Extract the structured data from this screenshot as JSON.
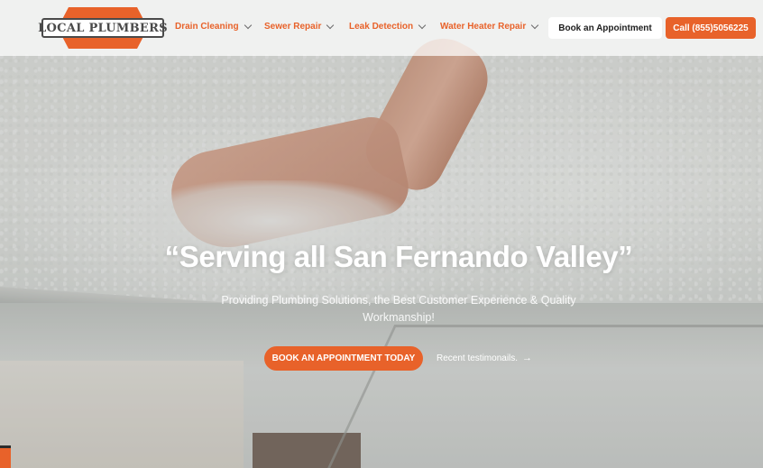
{
  "header": {
    "logo_text": "LOCAL PLUMBERS",
    "nav": [
      {
        "label": "Drain Cleaning"
      },
      {
        "label": "Sewer Repair"
      },
      {
        "label": "Leak Detection"
      },
      {
        "label": "Water Heater Repair"
      }
    ],
    "book_button": "Book an Appointment",
    "call_button": "Call (855)5056225"
  },
  "hero": {
    "headline": "“Serving all San Fernando Valley”",
    "subtext": "Providing Plumbing Solutions, the Best Customer Experience & Quality Workmanship!",
    "cta": "BOOK AN APPOINTMENT TODAY",
    "testimonials_link": "Recent testimonails.",
    "testimonials_arrow": "→"
  },
  "colors": {
    "accent": "#e8622a",
    "header_bg": "#ffffff",
    "text_dark": "#1e1e1e"
  },
  "icons": {
    "nav_chevron": "chevron-down-icon",
    "link_arrow": "arrow-right-icon"
  }
}
